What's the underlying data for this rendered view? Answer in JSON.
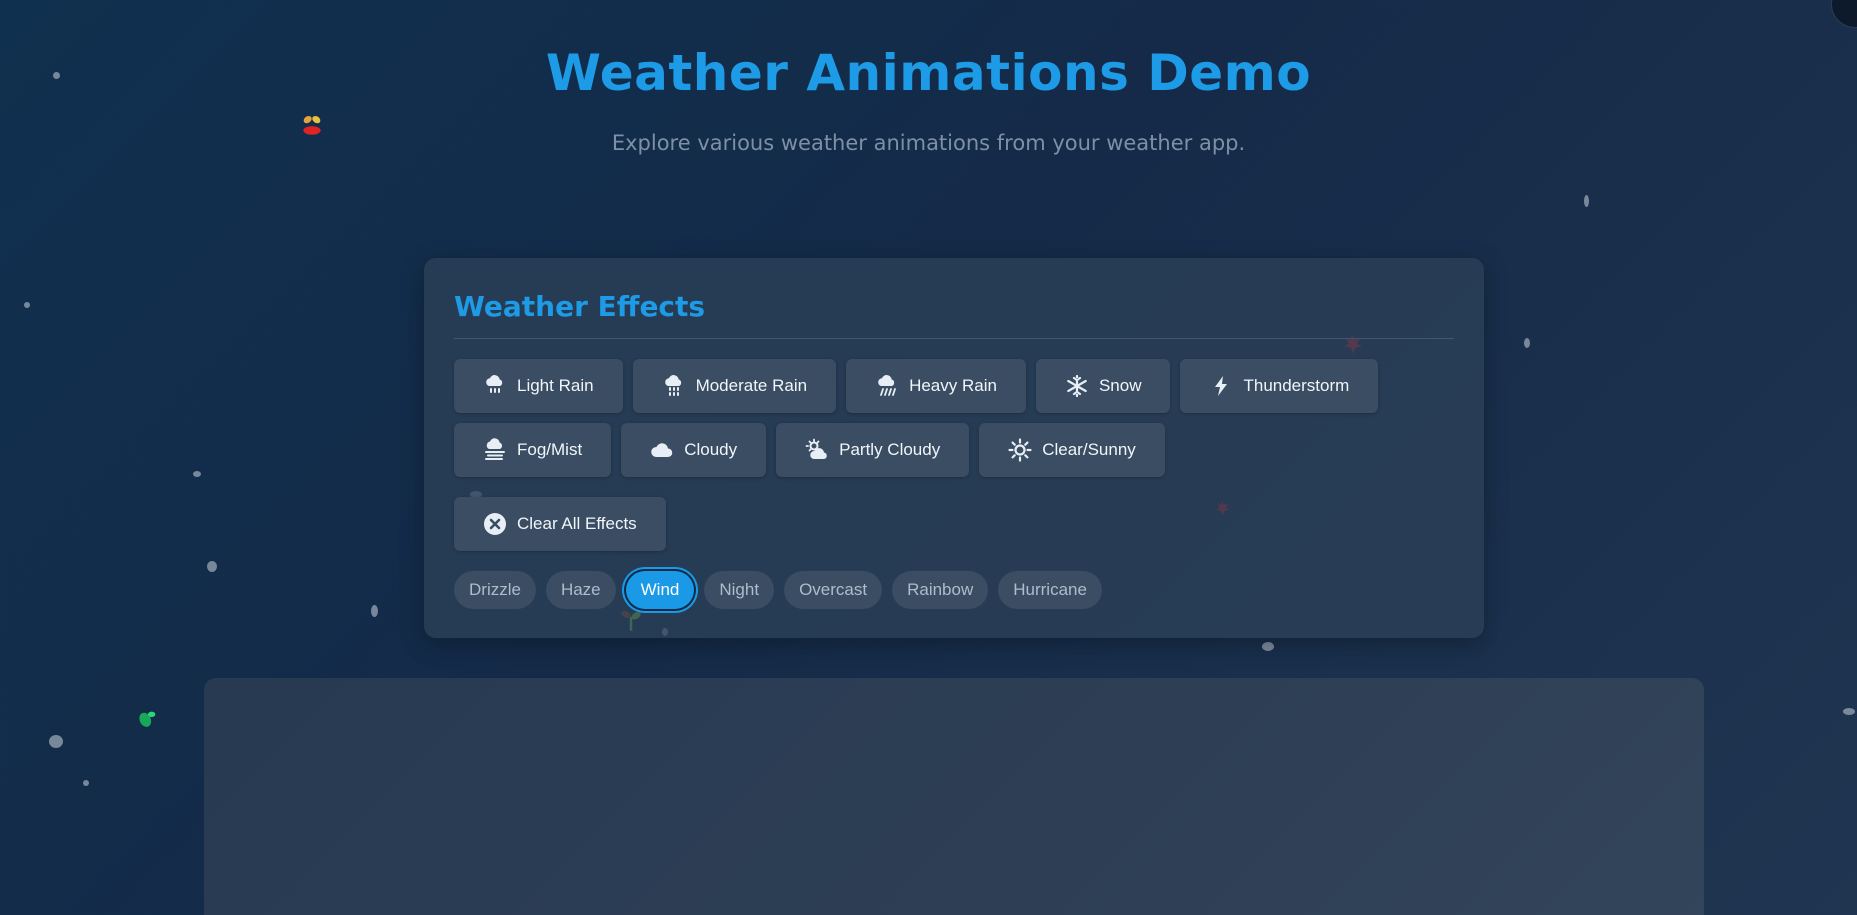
{
  "header": {
    "title": "Weather Animations Demo",
    "subtitle": "Explore various weather animations from your weather app."
  },
  "panel": {
    "title": "Weather Effects",
    "row1": [
      {
        "label": "Light Rain",
        "icon": "light-rain-icon"
      },
      {
        "label": "Moderate Rain",
        "icon": "moderate-rain-icon"
      },
      {
        "label": "Heavy Rain",
        "icon": "heavy-rain-icon"
      },
      {
        "label": "Snow",
        "icon": "snowflake-icon"
      },
      {
        "label": "Thunderstorm",
        "icon": "lightning-icon"
      }
    ],
    "row2": [
      {
        "label": "Fog/Mist",
        "icon": "fog-icon"
      },
      {
        "label": "Cloudy",
        "icon": "cloud-icon"
      },
      {
        "label": "Partly Cloudy",
        "icon": "partly-cloudy-icon"
      },
      {
        "label": "Clear/Sunny",
        "icon": "sun-icon"
      }
    ],
    "clear_all": {
      "label": "Clear All Effects",
      "icon": "close-circle-icon"
    },
    "chips": [
      {
        "label": "Drizzle",
        "active": false
      },
      {
        "label": "Haze",
        "active": false
      },
      {
        "label": "Wind",
        "active": true
      },
      {
        "label": "Night",
        "active": false
      },
      {
        "label": "Overcast",
        "active": false
      },
      {
        "label": "Rainbow",
        "active": false
      },
      {
        "label": "Hurricane",
        "active": false
      }
    ]
  },
  "colors": {
    "accent": "#1e9be6",
    "button_bg": "#3a4d63",
    "panel_bg": "#2e4259",
    "subtitle": "#7d90a6"
  }
}
